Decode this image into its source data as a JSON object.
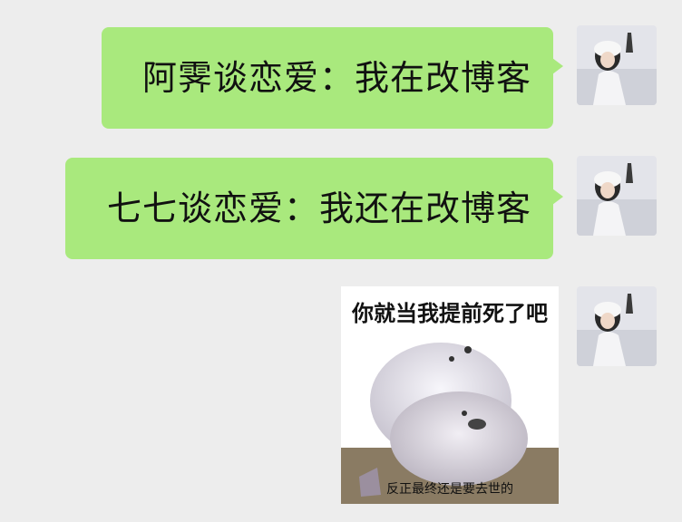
{
  "messages": [
    {
      "type": "text",
      "text": "阿霁谈恋爱：我在改博客"
    },
    {
      "type": "text",
      "text": "七七谈恋爱：我还在改博客"
    },
    {
      "type": "sticker",
      "top_text": "你就当我提前死了吧",
      "bottom_text": "反正最终还是要去世的"
    }
  ],
  "colors": {
    "background": "#ededed",
    "bubble": "#a9e97d"
  },
  "icons": {
    "avatar": "avatar-photo"
  }
}
